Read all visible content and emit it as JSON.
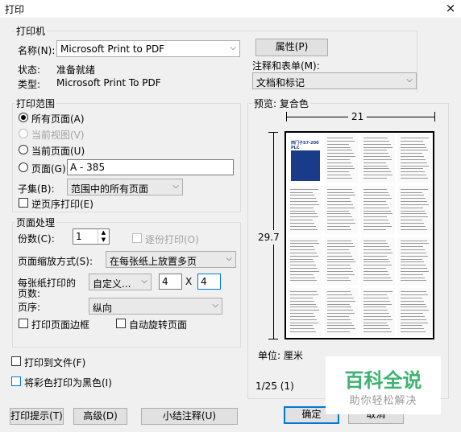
{
  "window": {
    "title": "打印",
    "close_icon": "×"
  },
  "printer": {
    "group_title": "打印机",
    "name_label": "名称(N):",
    "name_value": "Microsoft Print to PDF",
    "properties_button": "属性(P)",
    "status_label": "状态:",
    "status_value": "准备就绪",
    "type_label": "类型:",
    "type_value": "Microsoft Print To PDF",
    "comments_label": "注释和表单(M):",
    "comments_value": "文档和标记"
  },
  "range": {
    "group_title": "打印范围",
    "all_pages": "所有页面(A)",
    "current_view": "当前视图(V)",
    "current_page": "当前页面(U)",
    "pages": "页面(G)",
    "pages_value": "A - 385",
    "subset_label": "子集(B):",
    "subset_value": "范围中的所有页面",
    "reverse": "逆页序打印(E)"
  },
  "handling": {
    "group_title": "页面处理",
    "copies_label": "份数(C):",
    "copies_value": "1",
    "collate": "逐份打印(O)",
    "scaling_label": "页面缩放方式(S):",
    "scaling_value": "在每张纸上放置多页",
    "pps_label_1": "每张纸打印的",
    "pps_label_2": "页数:",
    "pps_value": "自定义...",
    "cols": "4",
    "x": "X",
    "rows": "4",
    "order_label": "页序:",
    "order_value": "纵向",
    "borders": "打印页面边框",
    "autorotate": "自动旋转页面"
  },
  "options": {
    "print_to_file": "打印到文件(F)",
    "grayscale": "将彩色打印为黑色(I)"
  },
  "preview": {
    "label": "预览: 复合色",
    "width_value": "21",
    "height_value": "29.7",
    "units": "单位: 厘米",
    "page_counter": "1/25 (1)",
    "book_title": "西门子S7-200 PLC"
  },
  "buttons": {
    "tips": "打印提示(T)",
    "advanced": "高级(D)",
    "summarize": "小结注释(U)",
    "ok": "确定",
    "cancel": "取消"
  },
  "watermark": {
    "main": "百科全说",
    "sub": "助你轻松解决"
  },
  "colors": {
    "accent": "#0078d7",
    "watermark_green": "#3cb371"
  }
}
